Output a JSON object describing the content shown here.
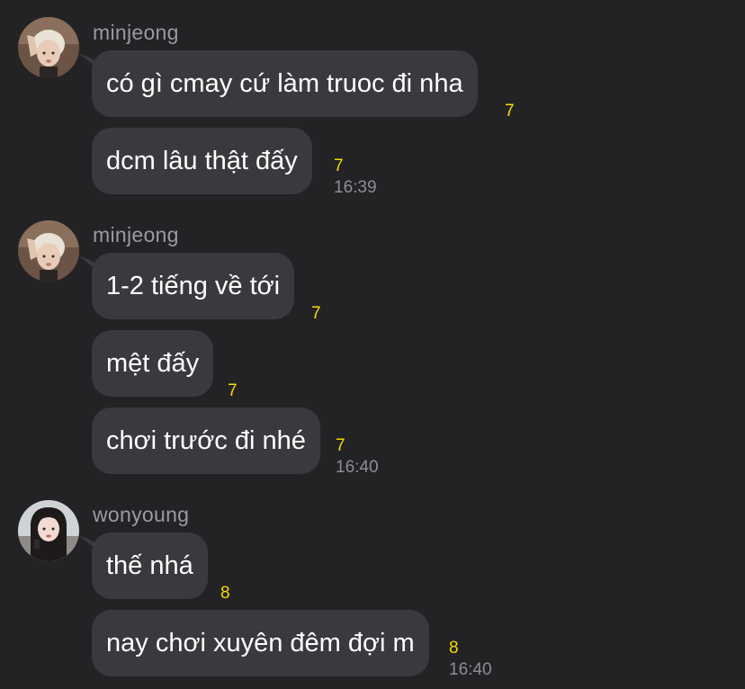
{
  "groups": [
    {
      "sender": "minjeong",
      "avatar_icon": "profile-photo-icon",
      "messages": [
        {
          "text": "có gì cmay cứ làm truoc đi nha",
          "unread": "7",
          "time": ""
        },
        {
          "text": "dcm lâu thật đấy",
          "unread": "7",
          "time": "16:39"
        }
      ]
    },
    {
      "sender": "minjeong",
      "avatar_icon": "profile-photo-icon",
      "messages": [
        {
          "text": "1-2 tiếng về tới",
          "unread": "7",
          "time": ""
        },
        {
          "text": "mệt đấy",
          "unread": "7",
          "time": ""
        },
        {
          "text": "chơi trước đi nhé",
          "unread": "7",
          "time": "16:40"
        }
      ]
    },
    {
      "sender": "wonyoung",
      "avatar_icon": "profile-photo-icon",
      "messages": [
        {
          "text": "thế nhá",
          "unread": "8",
          "time": ""
        },
        {
          "text": "nay chơi xuyên đêm đợi m",
          "unread": "8",
          "time": "16:40"
        }
      ]
    }
  ],
  "colors": {
    "background": "#232325",
    "bubble": "#3a3a3e",
    "unread": "#f5d90a",
    "meta": "#8d8d92"
  }
}
